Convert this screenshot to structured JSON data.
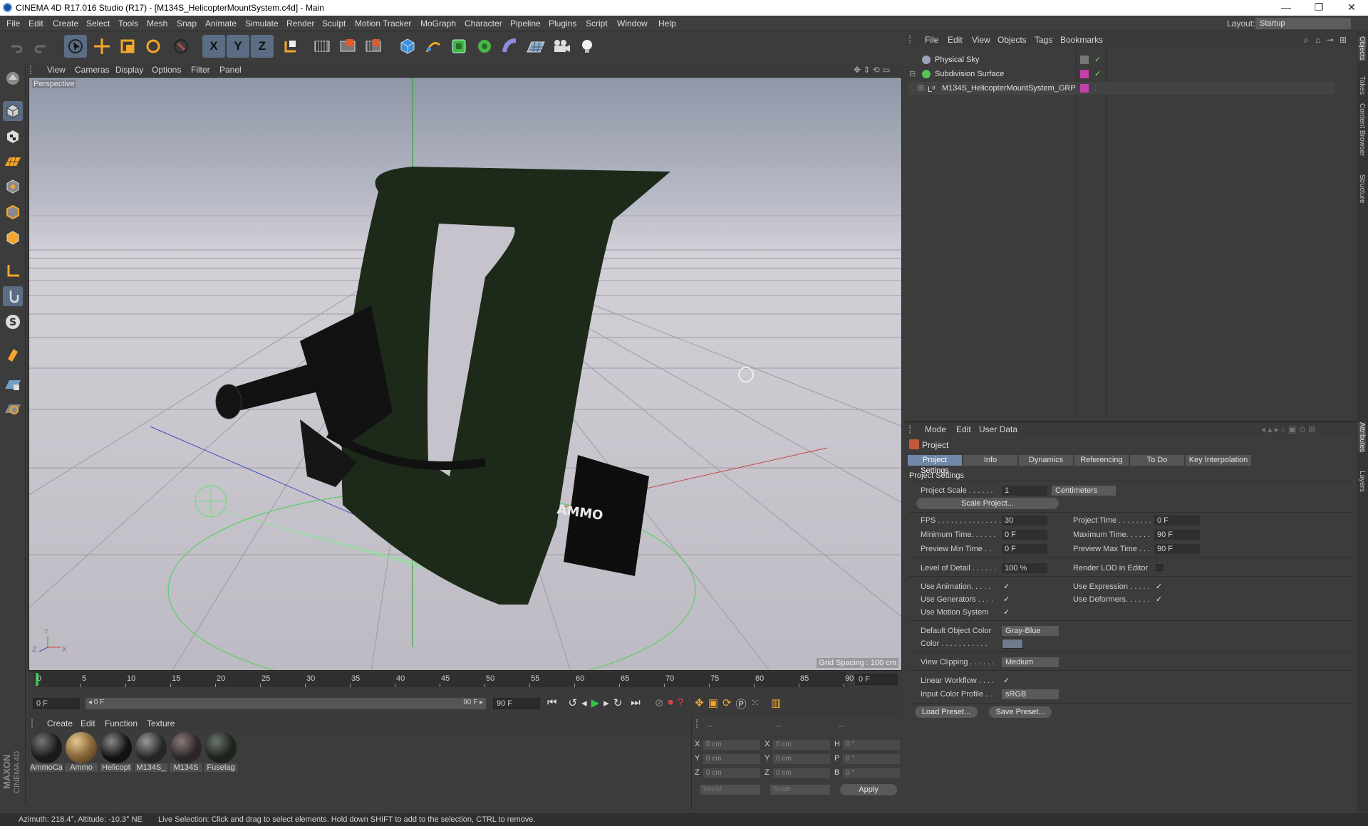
{
  "window": {
    "title": "CINEMA 4D R17.016 Studio (R17) - [M134S_HelicopterMountSystem.c4d] - Main",
    "minimize_glyph": "—",
    "restore_glyph": "❐",
    "close_glyph": "✕"
  },
  "menubar": {
    "items": [
      "File",
      "Edit",
      "Create",
      "Select",
      "Tools",
      "Mesh",
      "Snap",
      "Animate",
      "Simulate",
      "Render",
      "Sculpt",
      "Motion Tracker",
      "MoGraph",
      "Character",
      "Pipeline",
      "Plugins",
      "Script",
      "Window",
      "Help"
    ],
    "layout_label": "Layout:",
    "layout_value": "Startup"
  },
  "toolbar": {
    "axis_x": "X",
    "axis_y": "Y",
    "axis_z": "Z"
  },
  "viewport": {
    "menu": [
      "View",
      "Cameras",
      "Display",
      "Options",
      "Filter",
      "Panel"
    ],
    "camera_label": "Perspective",
    "grid_spacing": "Grid Spacing : 100 cm",
    "ammo_text": "AMMO",
    "axis_labels": {
      "z": "Z",
      "y": "Y",
      "x": "X"
    }
  },
  "timeline": {
    "ticks": [
      "0",
      "5",
      "10",
      "15",
      "20",
      "25",
      "30",
      "35",
      "40",
      "45",
      "50",
      "55",
      "60",
      "65",
      "70",
      "75",
      "80",
      "85",
      "90"
    ],
    "current_frame": "0 F",
    "start_field": "0 F",
    "range_start": "◂ 0 F",
    "range_end": "90 F ▸",
    "end_field": "90 F"
  },
  "materials": {
    "menu": [
      "Create",
      "Edit",
      "Function",
      "Texture"
    ],
    "items": [
      {
        "name": "AmmoCa",
        "color": "#1a1a1a"
      },
      {
        "name": "Ammo",
        "color": "#8a6a3a"
      },
      {
        "name": "Helicopt",
        "color": "#121212"
      },
      {
        "name": "M134S_",
        "color": "#262626"
      },
      {
        "name": "M134S",
        "color": "#2c2626"
      },
      {
        "name": "Fuselag",
        "color": "#1d231d"
      }
    ]
  },
  "coordinates": {
    "dashes": [
      "--",
      "--",
      "--"
    ],
    "rows": [
      {
        "a": "X",
        "av": "0 cm",
        "b": "X",
        "bv": "0 cm",
        "c": "H",
        "cv": "0 °"
      },
      {
        "a": "Y",
        "av": "0 cm",
        "b": "Y",
        "bv": "0 cm",
        "c": "P",
        "cv": "0 °"
      },
      {
        "a": "Z",
        "av": "0 cm",
        "b": "Z",
        "bv": "0 cm",
        "c": "B",
        "cv": "0 °"
      }
    ],
    "world": "World",
    "scale": "Scale",
    "apply": "Apply"
  },
  "status": {
    "left": "Azimuth: 218.4°, Altitude: -10.3°  NE",
    "right": "Live Selection: Click and drag to select elements. Hold down SHIFT to add to the selection, CTRL to remove."
  },
  "branding": {
    "maxon": "MAXON",
    "product": "CINEMA 4D"
  },
  "objects": {
    "menu": [
      "File",
      "Edit",
      "View",
      "Objects",
      "Tags",
      "Bookmarks"
    ],
    "items": [
      {
        "name": "Physical Sky",
        "icon_color": "#9aa4b6"
      },
      {
        "name": "Subdivision Surface",
        "icon_color": "#55c455"
      },
      {
        "name": "M134S_HelicopterMountSystem_GRP",
        "icon_color": "#cfcfcf"
      }
    ]
  },
  "attributes": {
    "menu": [
      "Mode",
      "Edit",
      "User Data"
    ],
    "header": "Project",
    "tabs": [
      "Project Settings",
      "Info",
      "Dynamics",
      "Referencing",
      "To Do",
      "Key Interpolation"
    ],
    "section": "Project Settings",
    "project_scale_label": "Project Scale . . . . . .",
    "project_scale_value": "1",
    "project_scale_unit": "Centimeters",
    "scale_project_btn": "Scale Project...",
    "fps_label": "FPS . . . . . . . . . . . . . . .",
    "fps_value": "30",
    "min_time_label": "Minimum Time. . . . . .",
    "min_time_value": "0 F",
    "preview_min_label": "Preview Min Time . .",
    "preview_min_value": "0 F",
    "project_time_label": "Project Time . . . . . . . .",
    "project_time_value": "0 F",
    "max_time_label": "Maximum Time. . . . . .",
    "max_time_value": "90 F",
    "preview_max_label": "Preview Max Time . . .",
    "preview_max_value": "90 F",
    "lod_label": "Level of Detail . . . . . .",
    "lod_value": "100 %",
    "render_lod_label": "Render LOD in Editor",
    "use_animation": "Use Animation. . . . .",
    "use_generators": "Use Generators . . . .",
    "use_motion": "Use Motion System",
    "use_expression": "Use Expression . . . . .",
    "use_deformers": "Use Deformers. . . . . .",
    "check": "✓",
    "default_color_label": "Default Object Color",
    "default_color_value": "Gray-Blue",
    "color_label": "Color . . . . . . . . . . .",
    "color_swatch": "#6e7b8c",
    "view_clipping_label": "View Clipping . . . . . .",
    "view_clipping_value": "Medium",
    "linear_workflow_label": "Linear Workflow . . . .",
    "input_profile_label": "Input Color Profile . .",
    "input_profile_value": "sRGB",
    "load_preset": "Load Preset...",
    "save_preset": "Save Preset..."
  },
  "side_tabs": [
    "Objects",
    "Takes",
    "Content Browser",
    "Structure",
    "Attributes",
    "Layers"
  ]
}
